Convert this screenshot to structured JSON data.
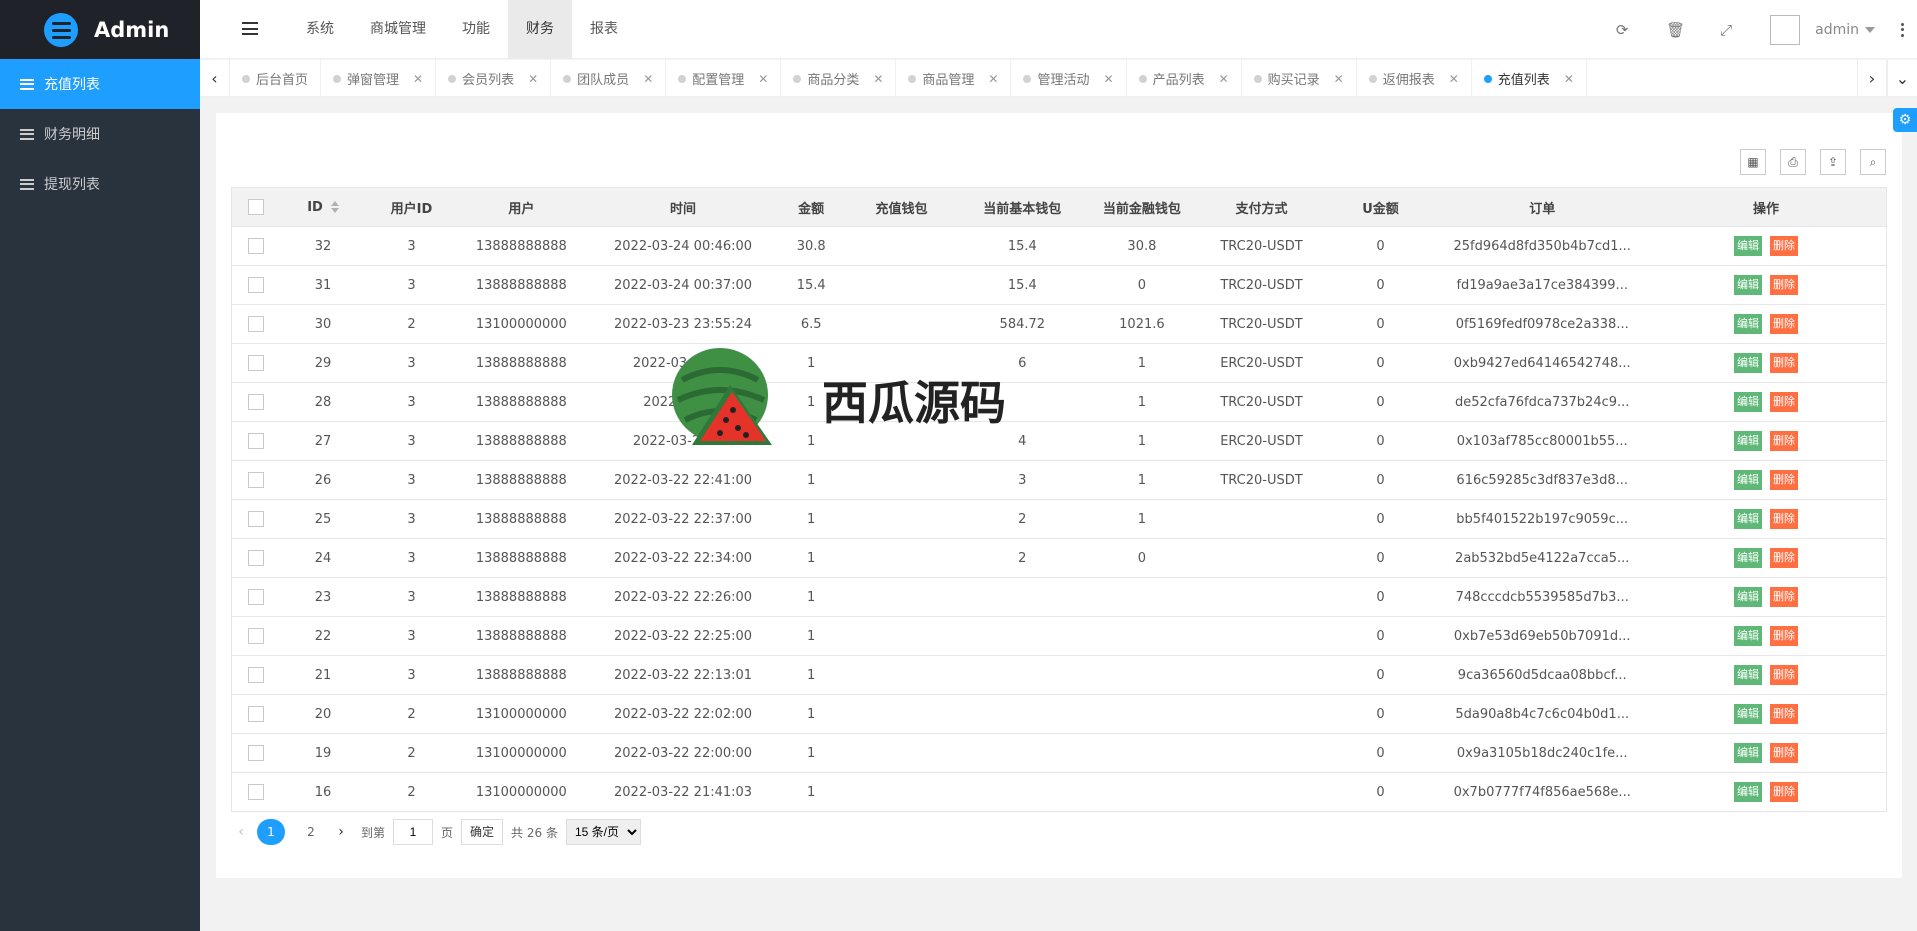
{
  "app": {
    "title": "Admin"
  },
  "sidebar": {
    "items": [
      {
        "label": "充值列表",
        "active": true
      },
      {
        "label": "财务明细",
        "active": false
      },
      {
        "label": "提现列表",
        "active": false
      }
    ]
  },
  "header": {
    "nav": [
      {
        "label": "系统",
        "active": false
      },
      {
        "label": "商城管理",
        "active": false
      },
      {
        "label": "功能",
        "active": false
      },
      {
        "label": "财务",
        "active": true
      },
      {
        "label": "报表",
        "active": false
      }
    ],
    "user": "admin",
    "icons": [
      "refresh-icon",
      "trash-icon",
      "fullscreen-icon",
      "more-icon"
    ]
  },
  "tabs": [
    {
      "label": "后台首页",
      "closable": false,
      "active": false
    },
    {
      "label": "弹窗管理",
      "closable": true,
      "active": false
    },
    {
      "label": "会员列表",
      "closable": true,
      "active": false
    },
    {
      "label": "团队成员",
      "closable": true,
      "active": false
    },
    {
      "label": "配置管理",
      "closable": true,
      "active": false
    },
    {
      "label": "商品分类",
      "closable": true,
      "active": false
    },
    {
      "label": "商品管理",
      "closable": true,
      "active": false
    },
    {
      "label": "管理活动",
      "closable": true,
      "active": false
    },
    {
      "label": "产品列表",
      "closable": true,
      "active": false
    },
    {
      "label": "购买记录",
      "closable": true,
      "active": false
    },
    {
      "label": "返佣报表",
      "closable": true,
      "active": false
    },
    {
      "label": "充值列表",
      "closable": true,
      "active": true
    }
  ],
  "table": {
    "columns": [
      "ID",
      "用户ID",
      "用户",
      "时间",
      "金额",
      "充值钱包",
      "当前基本钱包",
      "当前金融钱包",
      "支付方式",
      "U金额",
      "订单",
      "操作"
    ],
    "edit_label": "编辑",
    "delete_label": "删除",
    "rows": [
      [
        "32",
        "3",
        "13888888888",
        "2022-03-24 00:46:00",
        "30.8",
        "",
        "15.4",
        "30.8",
        "TRC20-USDT",
        "0",
        "25fd964d8fd350b4b7cd1..."
      ],
      [
        "31",
        "3",
        "13888888888",
        "2022-03-24 00:37:00",
        "15.4",
        "",
        "15.4",
        "0",
        "TRC20-USDT",
        "0",
        "fd19a9ae3a17ce384399..."
      ],
      [
        "30",
        "2",
        "13100000000",
        "2022-03-23 23:55:24",
        "6.5",
        "",
        "584.72",
        "1021.6",
        "TRC20-USDT",
        "0",
        "0f5169fedf0978ce2a338..."
      ],
      [
        "29",
        "3",
        "13888888888",
        "2022-03-23 1...",
        "1",
        "",
        "6",
        "1",
        "ERC20-USDT",
        "0",
        "0xb9427ed64146542748..."
      ],
      [
        "28",
        "3",
        "13888888888",
        "2022-03-2...",
        "1",
        "",
        "",
        "1",
        "TRC20-USDT",
        "0",
        "de52cfa76fdca737b24c9..."
      ],
      [
        "27",
        "3",
        "13888888888",
        "2022-03-22 2...",
        "1",
        "",
        "4",
        "1",
        "ERC20-USDT",
        "0",
        "0x103af785cc80001b55..."
      ],
      [
        "26",
        "3",
        "13888888888",
        "2022-03-22 22:41:00",
        "1",
        "",
        "3",
        "1",
        "TRC20-USDT",
        "0",
        "616c59285c3df837e3d8..."
      ],
      [
        "25",
        "3",
        "13888888888",
        "2022-03-22 22:37:00",
        "1",
        "",
        "2",
        "1",
        "",
        "0",
        "bb5f401522b197c9059c..."
      ],
      [
        "24",
        "3",
        "13888888888",
        "2022-03-22 22:34:00",
        "1",
        "",
        "2",
        "0",
        "",
        "0",
        "2ab532bd5e4122a7cca5..."
      ],
      [
        "23",
        "3",
        "13888888888",
        "2022-03-22 22:26:00",
        "1",
        "",
        "",
        "",
        "",
        "0",
        "748cccdcb5539585d7b3..."
      ],
      [
        "22",
        "3",
        "13888888888",
        "2022-03-22 22:25:00",
        "1",
        "",
        "",
        "",
        "",
        "0",
        "0xb7e53d69eb50b7091d..."
      ],
      [
        "21",
        "3",
        "13888888888",
        "2022-03-22 22:13:01",
        "1",
        "",
        "",
        "",
        "",
        "0",
        "9ca36560d5dcaa08bbcf..."
      ],
      [
        "20",
        "2",
        "13100000000",
        "2022-03-22 22:02:00",
        "1",
        "",
        "",
        "",
        "",
        "0",
        "5da90a8b4c7c6c04b0d1..."
      ],
      [
        "19",
        "2",
        "13100000000",
        "2022-03-22 22:00:00",
        "1",
        "",
        "",
        "",
        "",
        "0",
        "0x9a3105b18dc240c1fe..."
      ],
      [
        "16",
        "2",
        "13100000000",
        "2022-03-22 21:41:03",
        "1",
        "",
        "",
        "",
        "",
        "0",
        "0x7b0777f74f856ae568e..."
      ]
    ]
  },
  "pager": {
    "pages": [
      "1",
      "2"
    ],
    "current": "1",
    "goto_label": "到第",
    "goto_value": "1",
    "page_unit": "页",
    "confirm_label": "确定",
    "total_label": "共 26 条",
    "page_size": "15 条/页"
  },
  "watermark": {
    "text": "西瓜源码"
  },
  "colors": {
    "accent": "#1e9fff",
    "sidebar": "#28333e",
    "edit": "#5fb878",
    "delete": "#ff5722"
  }
}
